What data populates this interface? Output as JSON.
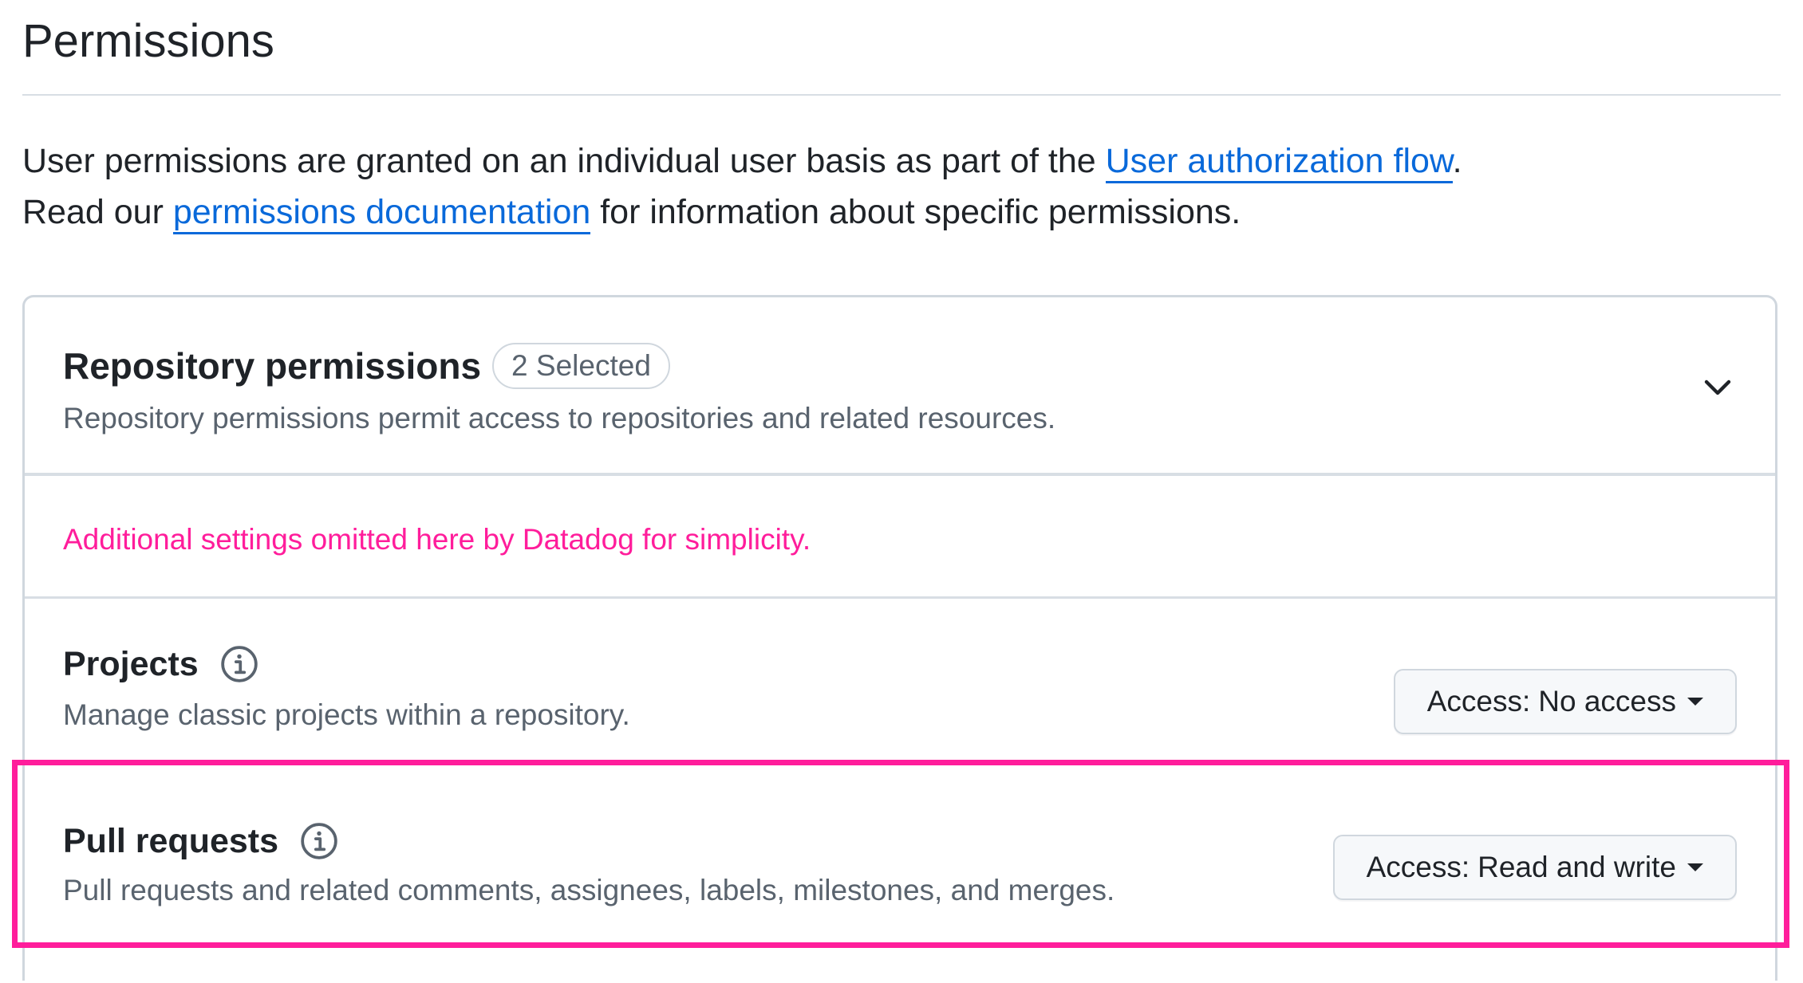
{
  "page": {
    "title": "Permissions"
  },
  "intro": {
    "line1_prefix": "User permissions are granted on an individual user basis as part of the ",
    "line1_link": "User authorization flow",
    "line1_suffix": ".",
    "line2_prefix": "Read our ",
    "line2_link": "permissions documentation",
    "line2_suffix": " for information about specific permissions."
  },
  "repository_permissions": {
    "title": "Repository permissions",
    "badge": "2 Selected",
    "description": "Repository permissions permit access to repositories and related resources.",
    "toggle_icon": "chevron-down-icon",
    "note": "Additional settings omitted here by Datadog for simplicity.",
    "items": [
      {
        "title": "Projects",
        "info_icon": "info-icon",
        "description": "Manage classic projects within a repository.",
        "access_prefix": "Access:",
        "access_value": "No access"
      },
      {
        "title": "Pull requests",
        "info_icon": "info-icon",
        "description": "Pull requests and related comments, assignees, labels, milestones, and merges.",
        "access_prefix": "Access:",
        "access_value": "Read and write",
        "highlighted": true
      }
    ]
  },
  "colors": {
    "link": "#0969da",
    "highlight": "#ff1d9b",
    "muted_text": "#59636e",
    "border": "#d0d7de"
  }
}
